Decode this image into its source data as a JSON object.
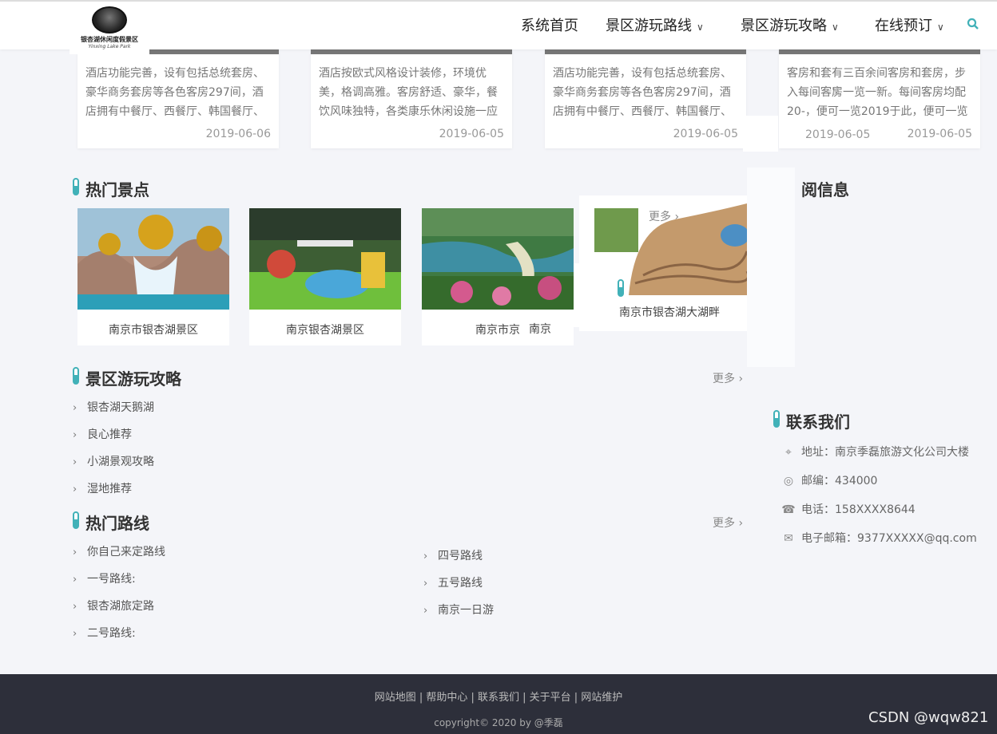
{
  "header": {
    "logo": {
      "title": "银杏湖休闲度假景区",
      "subtitle": "Yinxing Lake Park"
    },
    "nav": [
      {
        "label": "系统首页"
      },
      {
        "label": "景区游玩路线",
        "has_dropdown": true
      },
      {
        "label": "景区游玩攻略",
        "has_dropdown": true
      },
      {
        "label": "在线预订",
        "has_dropdown": true
      }
    ],
    "search_icon": "search-icon"
  },
  "hotel_cards": [
    {
      "text": "酒店功能完善，设有包括总统套房、豪华商务套房等各色客房297间，酒店拥有中餐厅、西餐厅、韩国餐厅、",
      "date": "2019-06-06"
    },
    {
      "text": "酒店按欧式风格设计装修，环境优美，格调高雅。客房舒适、豪华，餐饮风味独特，各类康乐休闲设施一应",
      "date": "2019-06-05"
    },
    {
      "text": "酒店功能完善，设有包括总统套房、豪华商务套房等各色客房297间，酒店拥有中餐厅、西餐厅、韩国餐厅、",
      "date": "2019-06-05"
    },
    {
      "text": "客房和套有三百余间客房和套房，步入每间客房一览一新。每间客房均配20-，便可一览2019于此，便可一览壮",
      "date": "2019-06-05"
    }
  ],
  "card4_extra": {
    "date": "2019-06-05",
    "fragment": "一览",
    "lead": "20-，便可一览"
  },
  "hot_spots": {
    "title": "热门景点",
    "more": "更多",
    "items": [
      {
        "caption": "南京市银杏湖景区"
      },
      {
        "caption": "南京银杏湖景区"
      },
      {
        "caption": "南京市京"
      },
      {
        "caption": "南京市银杏湖大湖畔"
      }
    ],
    "glitch_caption": "南京"
  },
  "notice": {
    "title": "阅信息"
  },
  "guides": {
    "title": "景区游玩攻略",
    "more": "更多",
    "items": [
      "银杏湖天鹅湖",
      "良心推荐",
      "小湖景观攻略",
      "湿地推荐"
    ]
  },
  "routes": {
    "title": "热门路线",
    "more": "更多",
    "col1": [
      "你自己来定路线",
      "一号路线:",
      "银杏湖旅定路",
      "二号路线:"
    ],
    "col2": [
      "四号路线",
      "五号路线",
      "南京一日游"
    ]
  },
  "contact": {
    "title": "联系我们",
    "items": [
      {
        "icon": "map-pin-icon",
        "text": "地址：南京季磊旅游文化公司大楼"
      },
      {
        "icon": "compass-icon",
        "text": "邮编：434000"
      },
      {
        "icon": "phone-icon",
        "text": "电话：158XXXX8644"
      },
      {
        "icon": "envelope-icon",
        "text": "电子邮箱：9377XXXXX@qq.com"
      }
    ]
  },
  "footer": {
    "links": "网站地图 | 帮助中心 | 联系我们 | 关于平台 | 网站维护",
    "copyright": "copyright© 2020 by @季磊"
  },
  "watermark": "CSDN @wqw821",
  "colors": {
    "accent": "#41b1b8",
    "footer_bg": "#2d2f3a"
  }
}
